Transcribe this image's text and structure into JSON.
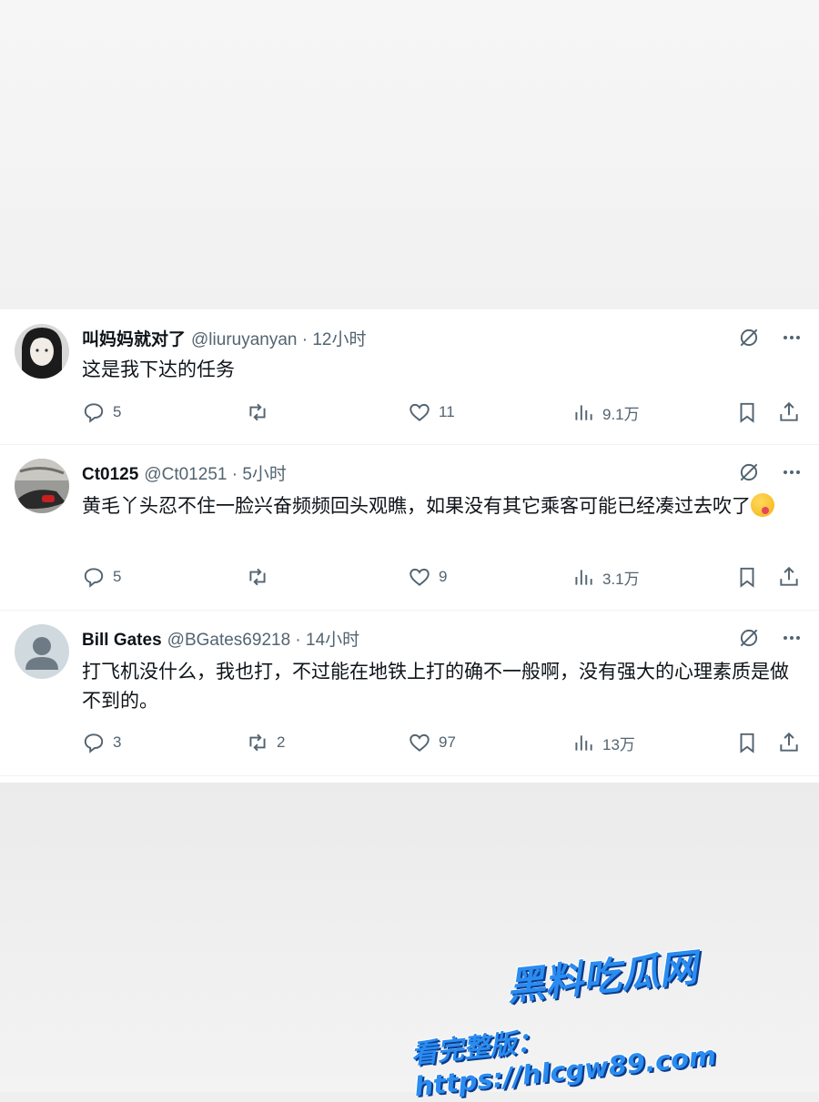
{
  "tweets": [
    {
      "name": "叫妈妈就对了",
      "meta": "@liuruyanyan · 12小时",
      "text": "这是我下达的任务",
      "replies": "5",
      "retweets": "",
      "likes": "11",
      "views": "9.1万"
    },
    {
      "name": "Ct0125",
      "meta": "@Ct01251 · 5小时",
      "text": "黄毛丫头忍不住一脸兴奋频频回头观瞧，如果没有其它乘客可能已经凑过去吹了",
      "replies": "5",
      "retweets": "",
      "likes": "9",
      "views": "3.1万"
    },
    {
      "name": "Bill Gates",
      "meta": "@BGates69218 · 14小时",
      "text": "打飞机没什么，我也打，不过能在地铁上打的确不一般啊，没有强大的心理素质是做不到的。",
      "replies": "3",
      "retweets": "2",
      "likes": "97",
      "views": "13万"
    }
  ],
  "watermark": {
    "line1": "黑料吃瓜网",
    "line2": "看完整版：https://hlcgw89.com"
  },
  "icons": {
    "reply": "reply-icon",
    "retweet": "retweet-icon",
    "like": "heart-icon",
    "views": "views-chart-icon",
    "bookmark": "bookmark-icon",
    "share": "share-icon",
    "grok": "grok-icon",
    "more": "more-icon"
  },
  "colors": {
    "text": "#0f1419",
    "secondary": "#536471",
    "watermark": "#2a8cf0"
  }
}
